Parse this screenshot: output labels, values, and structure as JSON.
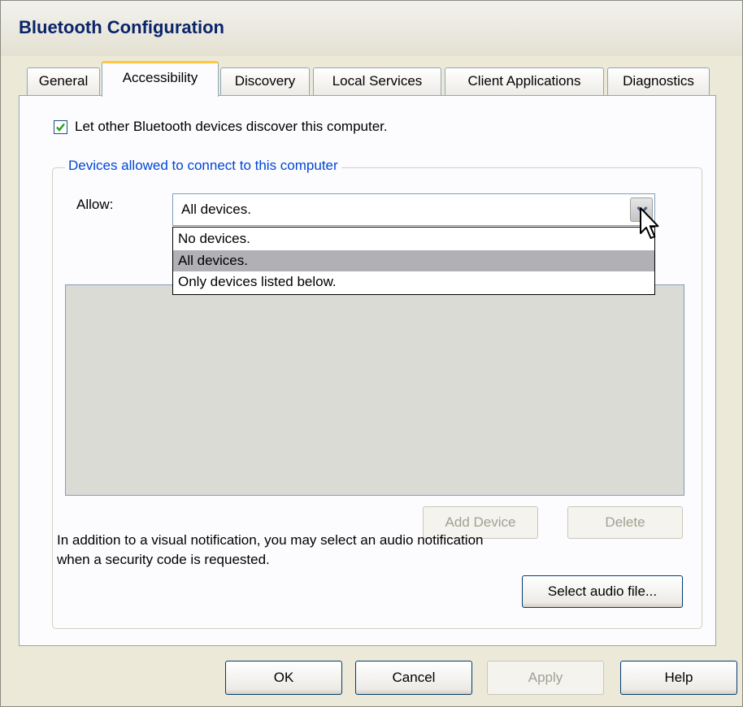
{
  "window": {
    "title": "Bluetooth Configuration"
  },
  "tabs": [
    {
      "label": "General",
      "active": false
    },
    {
      "label": "Accessibility",
      "active": true
    },
    {
      "label": "Discovery",
      "active": false
    },
    {
      "label": "Local Services",
      "active": false
    },
    {
      "label": "Client Applications",
      "active": false
    },
    {
      "label": "Diagnostics",
      "active": false
    }
  ],
  "accessibility": {
    "discover_checkbox": {
      "label": "Let other Bluetooth devices discover this computer.",
      "checked": true
    },
    "group_title": "Devices allowed to connect to this computer",
    "allow_label": "Allow:",
    "allow_value": "All devices.",
    "dropdown_options": [
      "No devices.",
      "All devices.",
      "Only devices listed below."
    ],
    "selected_option_index": 1,
    "add_device_label": "Add Device",
    "delete_label": "Delete",
    "notification_text": "In addition to a visual notification, you may select an audio notification when a security code is requested.",
    "select_audio_label": "Select audio file..."
  },
  "footer": {
    "ok_label": "OK",
    "cancel_label": "Cancel",
    "apply_label": "Apply",
    "help_label": "Help"
  },
  "icons": {
    "checkmark": "checkmark-icon",
    "dropdown_arrow": "chevron-down-icon",
    "cursor": "mouse-pointer-icon"
  },
  "colors": {
    "dialog_bg": "#ece9d8",
    "panel_bg": "#fcfcfe",
    "title_text": "#0a246a",
    "group_title": "#0046d5",
    "active_tab_accent": "#ffc83c",
    "selected_option_bg": "#b0b0b5",
    "checkmark": "#21a121"
  }
}
